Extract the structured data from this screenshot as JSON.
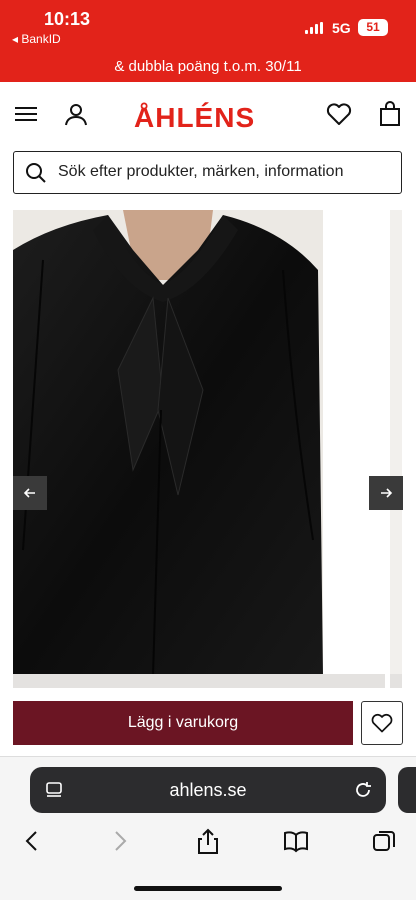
{
  "status": {
    "time": "10:13",
    "back_app": "◂ BankID",
    "network": "5G",
    "battery": "51"
  },
  "promo": {
    "text": "& dubbla poäng t.o.m. 30/11"
  },
  "header": {
    "logo": "ÅHLÉNS"
  },
  "search": {
    "placeholder": "Sök efter produkter, märken, information"
  },
  "product": {
    "add_to_cart": "Lägg i varukorg"
  },
  "browser": {
    "url": "ahlens.se"
  },
  "colors": {
    "brand_red": "#e2231a",
    "cart_button": "#6b1523",
    "safari_bar": "#2c2c2e"
  },
  "icons": [
    "menu-icon",
    "user-icon",
    "heart-icon",
    "bag-icon",
    "search-icon",
    "arrow-left-icon",
    "arrow-right-icon",
    "reader-icon",
    "reload-icon",
    "back-icon",
    "forward-icon",
    "share-icon",
    "bookmarks-icon",
    "tabs-icon"
  ]
}
